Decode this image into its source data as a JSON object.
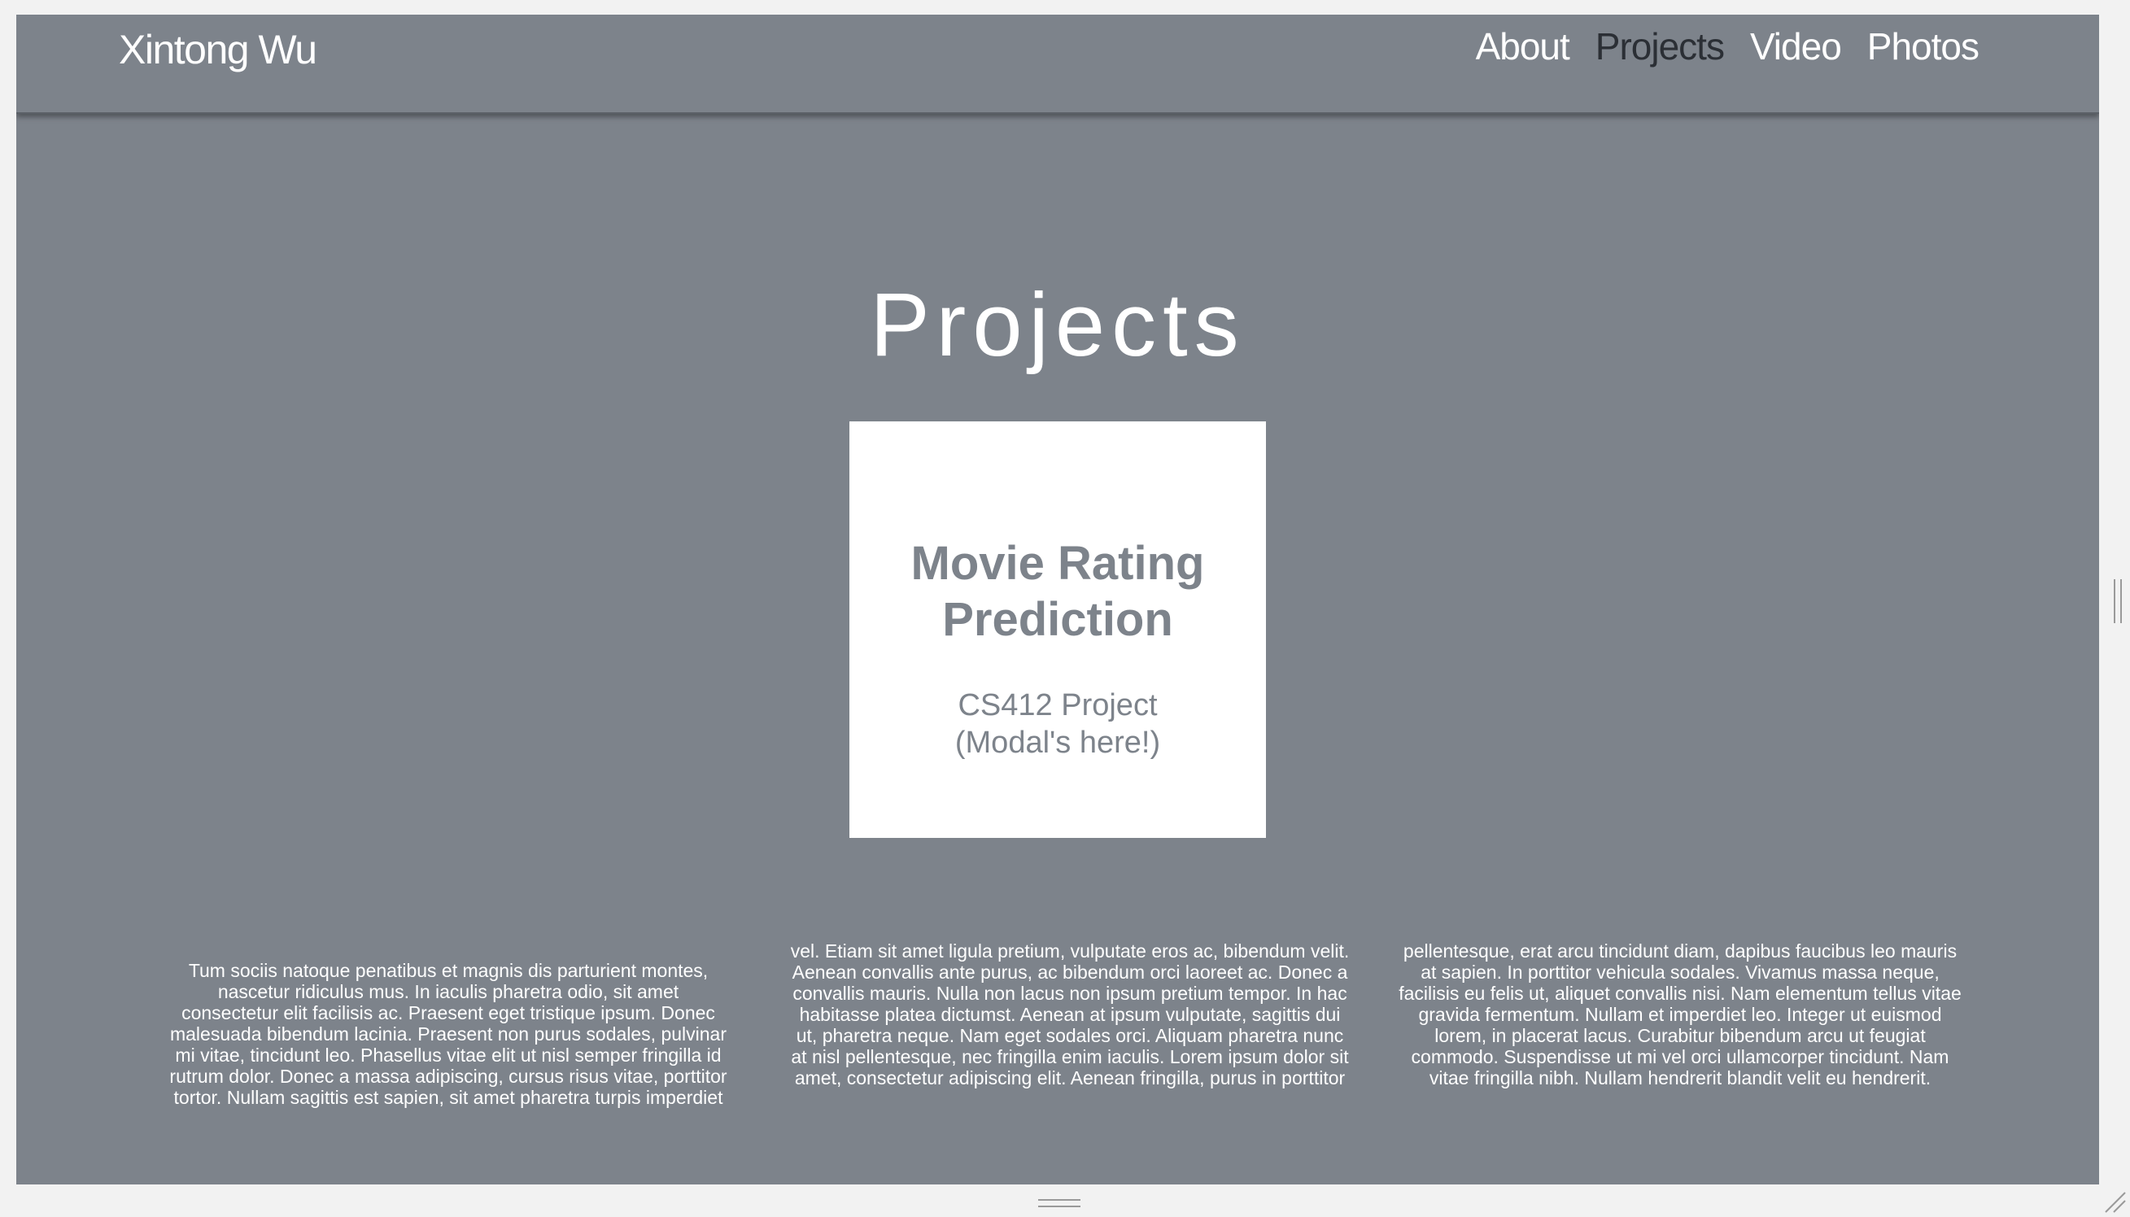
{
  "navbar": {
    "brand": "Xintong Wu",
    "links": [
      "About",
      "Projects",
      "Video",
      "Photos"
    ],
    "active": "Projects"
  },
  "page": {
    "title": "Projects"
  },
  "card": {
    "title_line1": "Movie Rating",
    "title_line2": "Prediction",
    "subtitle_line1": "CS412 Project",
    "subtitle_line2": "(Modal's here!)"
  },
  "columns": {
    "col1": [
      "Tum sociis natoque penatibus et magnis dis parturient montes,",
      "nascetur ridiculus mus. In iaculis pharetra odio, sit amet",
      "consectetur elit facilisis ac. Praesent eget tristique ipsum. Donec",
      "malesuada bibendum lacinia. Praesent non purus sodales, pulvinar",
      "mi vitae, tincidunt leo. Phasellus vitae elit ut nisl semper fringilla id",
      "rutrum dolor. Donec a massa adipiscing, cursus risus vitae, porttitor",
      "tortor. Nullam sagittis est sapien, sit amet pharetra turpis imperdiet"
    ],
    "col2": [
      "vel. Etiam sit amet ligula pretium, vulputate eros ac, bibendum velit.",
      "Aenean convallis ante purus, ac bibendum orci laoreet ac. Donec a",
      "convallis mauris. Nulla non lacus non ipsum pretium tempor. In hac",
      "habitasse platea dictumst. Aenean at ipsum vulputate, sagittis dui",
      "ut, pharetra neque. Nam eget sodales orci. Aliquam pharetra nunc",
      "at nisl pellentesque, nec fringilla enim iaculis. Lorem ipsum dolor sit",
      "amet, consectetur adipiscing elit. Aenean fringilla, purus in porttitor"
    ],
    "col3": [
      "pellentesque, erat arcu tincidunt diam, dapibus faucibus leo mauris",
      "at sapien. In porttitor vehicula sodales. Vivamus massa neque,",
      "facilisis eu felis ut, aliquet convallis nisi. Nam elementum tellus vitae",
      "gravida fermentum. Nullam et imperdiet leo. Integer ut euismod",
      "lorem, in placerat lacus. Curabitur bibendum arcu ut feugiat",
      "commodo. Suspendisse ut mi vel orci ullamcorper tincidunt. Nam",
      "vitae fringilla nibh. Nullam hendrerit blandit velit eu hendrerit."
    ]
  },
  "colors": {
    "background": "#7d838b",
    "card": "#ffffff",
    "active_link": "#2b2f35"
  }
}
